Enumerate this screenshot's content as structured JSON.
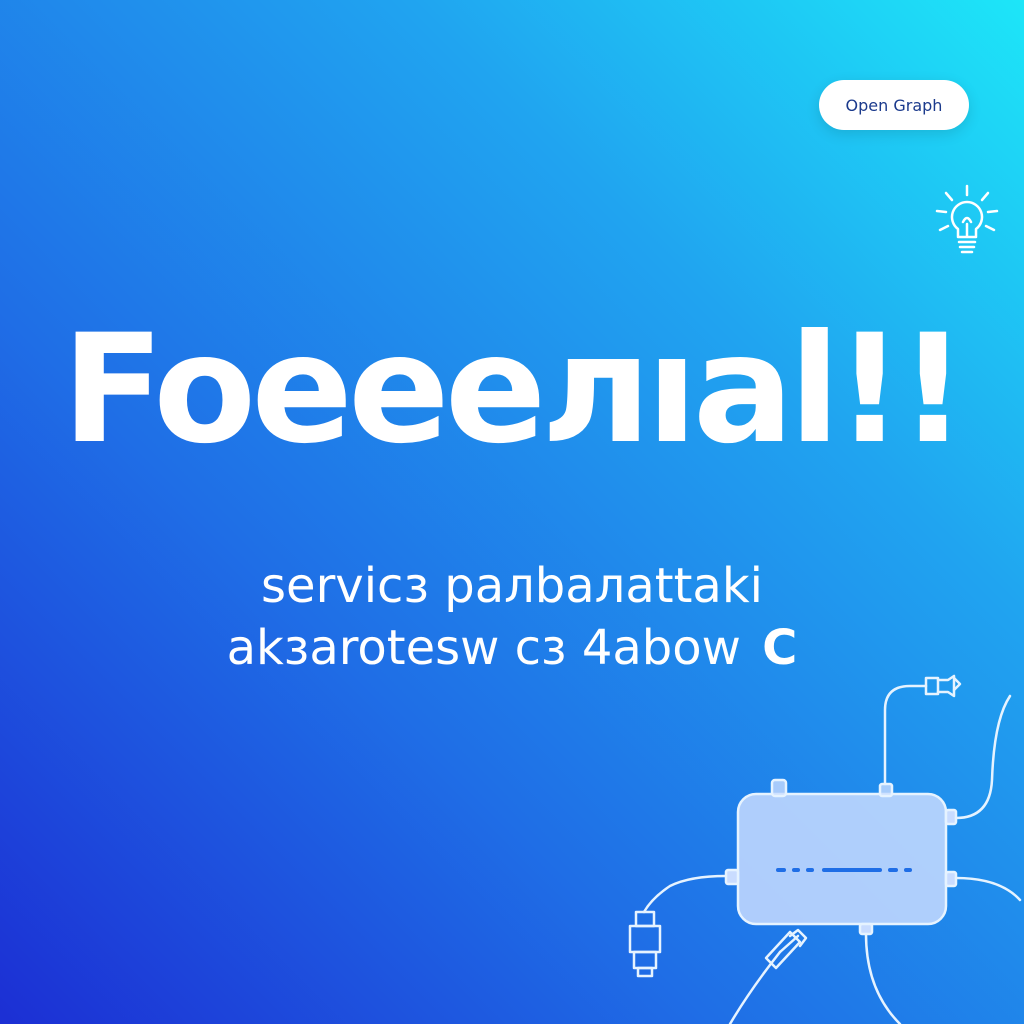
{
  "button": {
    "label": "Open Graph"
  },
  "headline": {
    "text": "Foeeелıal!!"
  },
  "subtitle": {
    "line1": "servicз paлbaлattaki",
    "line2": "akзarotesw cз 4abow",
    "trailing_glyph": "C"
  },
  "icons": {
    "idea": "lightbulb-icon",
    "device": "network-router-icon"
  },
  "colors": {
    "gradient_start": "#1c2fd4",
    "gradient_mid": "#1f6ee6",
    "gradient_end": "#1de6f8",
    "text": "#ffffff",
    "button_text": "#1b3a8c"
  }
}
